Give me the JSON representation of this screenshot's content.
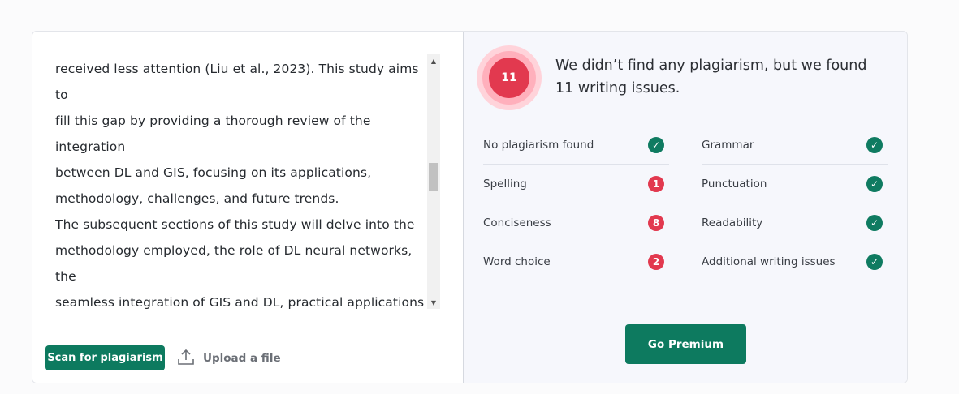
{
  "editor": {
    "text": "received less attention (Liu et al., 2023). This study aims to\nfill this gap by providing a thorough review of the integration\nbetween DL and GIS, focusing on its applications,\nmethodology, challenges, and future trends.\nThe subsequent sections of this study will delve into the\nmethodology employed, the role of DL neural networks, the\nseamless integration of GIS and DL, practical applications\nresulting from this amalgamation, identified gaps, potential\nfuture trends, and a comprehensive discussion and\nconclusion. Through this exploration, the study seeks to",
    "scan_label": "Scan for plagiarism",
    "upload_label": "Upload a file"
  },
  "results": {
    "issue_count": "11",
    "headline": "We didn’t find any plagiarism, but we found 11 writing issues.",
    "checks_left": [
      {
        "label": "No plagiarism found",
        "status": "ok",
        "value": "✓"
      },
      {
        "label": "Spelling",
        "status": "issue",
        "value": "1"
      },
      {
        "label": "Conciseness",
        "status": "issue",
        "value": "8"
      },
      {
        "label": "Word choice",
        "status": "issue",
        "value": "2"
      }
    ],
    "checks_right": [
      {
        "label": "Grammar",
        "status": "ok",
        "value": "✓"
      },
      {
        "label": "Punctuation",
        "status": "ok",
        "value": "✓"
      },
      {
        "label": "Readability",
        "status": "ok",
        "value": "✓"
      },
      {
        "label": "Additional writing issues",
        "status": "ok",
        "value": "✓"
      }
    ],
    "premium_label": "Go Premium"
  },
  "colors": {
    "accent_green": "#0d7a5f",
    "issue_red": "#e2394f"
  },
  "icons": {
    "upload": "upload-icon",
    "ok": "check-circle-icon",
    "issue": "count-circle-icon"
  }
}
